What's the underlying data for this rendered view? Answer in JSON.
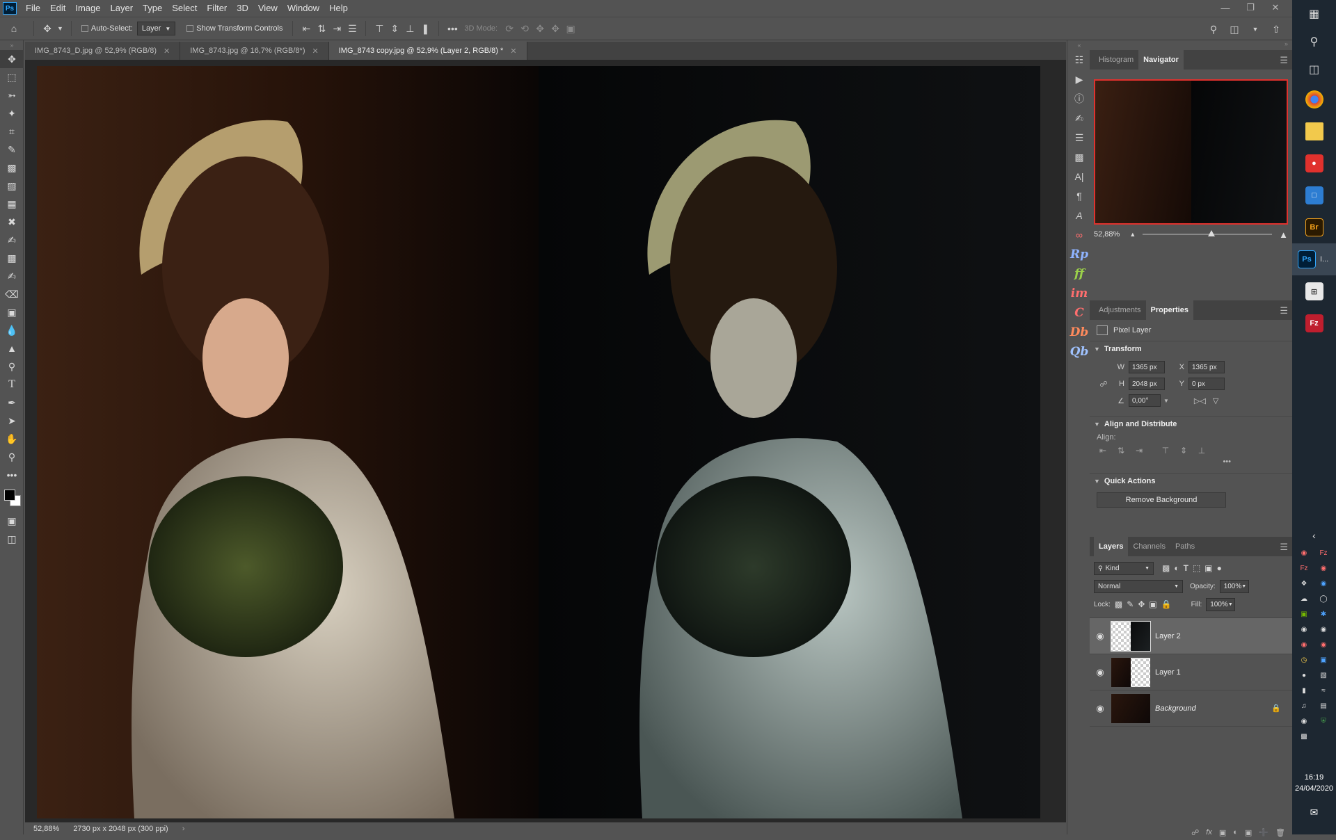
{
  "menu": {
    "logo": "Ps",
    "items": [
      "File",
      "Edit",
      "Image",
      "Layer",
      "Type",
      "Select",
      "Filter",
      "3D",
      "View",
      "Window",
      "Help"
    ]
  },
  "options": {
    "auto_select_label": "Auto-Select:",
    "auto_select_value": "Layer",
    "show_transform_label": "Show Transform Controls",
    "mode_3d_label": "3D Mode:"
  },
  "tabs": [
    {
      "label": "IMG_8743_D.jpg @ 52,9% (RGB/8)"
    },
    {
      "label": "IMG_8743.jpg @ 16,7% (RGB/8*)"
    },
    {
      "label": "IMG_8743 copy.jpg @ 52,9% (Layer 2, RGB/8) *"
    }
  ],
  "status": {
    "zoom": "52,88%",
    "doc_info": "2730 px x 2048 px (300 ppi)"
  },
  "plugins": [
    "Rp",
    "ff",
    "im",
    "C",
    "Db",
    "Qb"
  ],
  "plugin_colors": [
    "#8fb3ff",
    "#9bd04a",
    "#ff6e6e",
    "#ff6e6e",
    "#ff8a5c",
    "#9fc2ff"
  ],
  "navigator": {
    "tabs": [
      "Histogram",
      "Navigator"
    ],
    "active_tab": "Navigator",
    "zoom": "52,88%",
    "zoom_level_percent": 52.88
  },
  "properties": {
    "tabs": [
      "Adjustments",
      "Properties"
    ],
    "active_tab": "Properties",
    "layer_type": "Pixel Layer",
    "transform_title": "Transform",
    "w_label": "W",
    "w": "1365 px",
    "x_label": "X",
    "x": "1365 px",
    "h_label": "H",
    "h": "2048 px",
    "y_label": "Y",
    "y": "0 px",
    "angle": "0,00°",
    "align_title": "Align and Distribute",
    "align_label": "Align:",
    "quick_actions_title": "Quick Actions",
    "remove_bg_label": "Remove Background"
  },
  "layers": {
    "tabs": [
      "Layers",
      "Channels",
      "Paths"
    ],
    "active_tab": "Layers",
    "kind_label": "Kind",
    "blend_mode": "Normal",
    "opacity_label": "Opacity:",
    "opacity": "100%",
    "lock_label": "Lock:",
    "fill_label": "Fill:",
    "fill": "100%",
    "items": [
      {
        "name": "Layer 2",
        "selected": true
      },
      {
        "name": "Layer 1",
        "selected": false
      },
      {
        "name": "Background",
        "selected": false,
        "locked": true
      }
    ]
  },
  "taskbar": {
    "time": "16:19",
    "date": "24/04/2020",
    "ps_label": "I...",
    "br_label": "Br",
    "ps_app": "Ps",
    "fz_label": "Fz"
  },
  "colors": {
    "accent_red": "#e0312d",
    "ps_blue": "#31a8ff",
    "panel_bg": "#535353",
    "taskbar_bg": "#1d2731"
  }
}
